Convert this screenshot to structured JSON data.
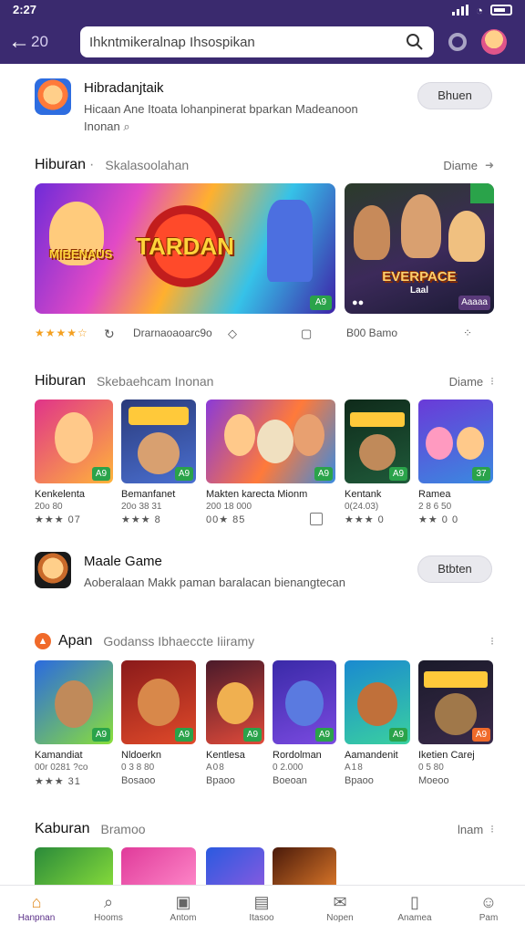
{
  "status": {
    "time": "2:27"
  },
  "topbar": {
    "back": "←",
    "number": "20",
    "search_text": "Ihkntmikeralnap Ihsospikan"
  },
  "promo1": {
    "title": "Hibradanjtaik",
    "desc": "Hicaan Ane Itoata lohanpinerat bparkan Madeanoon Inonan",
    "button": "Bhuen"
  },
  "section1": {
    "title": "Hiburan",
    "subtitle": "Skalasoolahan",
    "more": "Diame",
    "banners": [
      {
        "title": "TARDAN",
        "tagline": "MIBENAUS",
        "badge": "A9"
      },
      {
        "title": "EVERPACE",
        "tagline": "Laal",
        "badge": "Aaaaa"
      }
    ],
    "meta": {
      "stars": "★★★★☆",
      "text1": "Drarnaoaoarc9o",
      "text2": "B00 Bamo"
    }
  },
  "section2": {
    "title": "Hiburan",
    "subtitle": "Skebaehcam Inonan",
    "more": "Diame",
    "tiles": [
      {
        "name": "Kenkelenta",
        "sub": "20o 80",
        "rating": "★★★ 07",
        "badge": "A9"
      },
      {
        "name": "Bemanfanet",
        "sub": "20o 38 31",
        "rating": "★★★ 8",
        "badge": "A9"
      },
      {
        "name": "Makten karecta Mionm",
        "sub": "200 18 000",
        "rating": "00★ 85",
        "badge": "A9"
      },
      {
        "name": "Kentank",
        "sub": "0(24.03)",
        "rating": "★★★ 0",
        "badge": "A9"
      },
      {
        "name": "Ramea",
        "sub": "2 8 6 50",
        "rating": "★★ 0 0",
        "badge": "37"
      }
    ]
  },
  "promo2": {
    "title": "Maale Game",
    "desc": "Aoberalaan Makk paman baralacan bienangtecan",
    "button": "Btbten"
  },
  "section3": {
    "title": "Apan",
    "subtitle": "Godanss Ibhaeccte Iiiramy",
    "tiles": [
      {
        "name": "Kamandiat",
        "sub": "00r 0281 ?co",
        "rating": "★★★ 31",
        "badge": "A9"
      },
      {
        "name": "Nldoerkn",
        "sub": "0 3 8 80",
        "rating": "Bosaoo",
        "badge": "A9"
      },
      {
        "name": "Kentlesa",
        "sub": "A08",
        "rating": "Bpaoo",
        "badge": "A9"
      },
      {
        "name": "Rordolman",
        "sub": "0 2.000",
        "rating": "Boeoan",
        "badge": "A9"
      },
      {
        "name": "Aamandenit",
        "sub": "A18",
        "rating": "Bpaoo",
        "badge": "A9"
      },
      {
        "name": "Iketien Carej",
        "sub": "0 5 80",
        "rating": "Moeoo",
        "badge": "A9"
      }
    ]
  },
  "section4": {
    "title": "Kaburan",
    "subtitle": "Bramoo",
    "more": "lnam"
  },
  "nav": [
    {
      "label": "Hanpnan",
      "icon": "home-icon"
    },
    {
      "label": "Hooms",
      "icon": "search-icon"
    },
    {
      "label": "Antom",
      "icon": "apps-icon"
    },
    {
      "label": "Itasoo",
      "icon": "library-icon"
    },
    {
      "label": "Nopen",
      "icon": "offers-icon"
    },
    {
      "label": "Anamea",
      "icon": "games-icon"
    },
    {
      "label": "Pam",
      "icon": "profile-icon"
    }
  ],
  "colors": {
    "header": "#3b2a70",
    "accent": "#5a2f88",
    "badge": "#2aa34a",
    "star": "#f4a021"
  }
}
